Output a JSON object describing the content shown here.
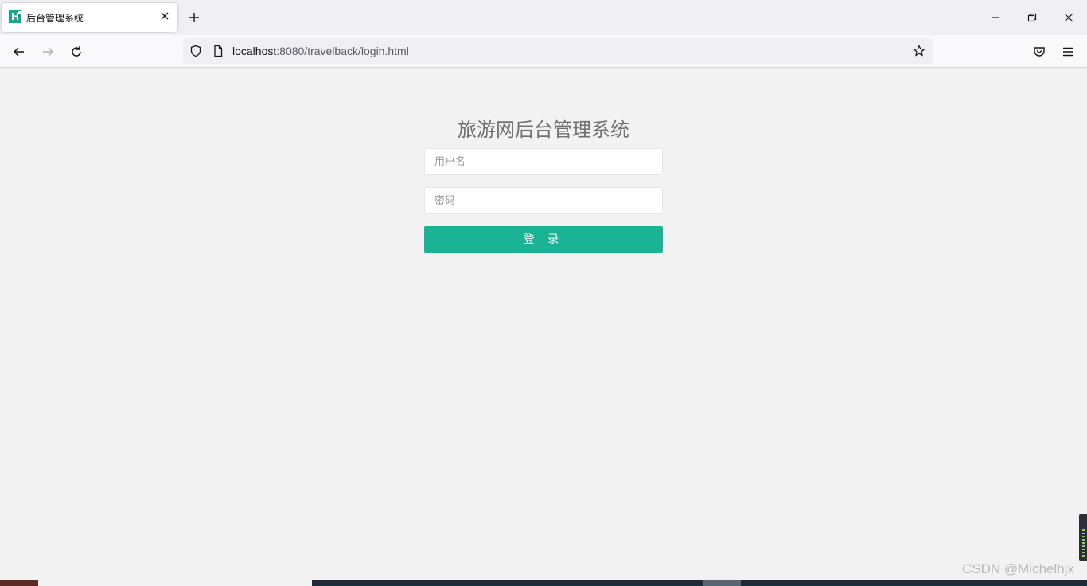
{
  "browser": {
    "tab": {
      "title": "后台管理系统",
      "favicon_letter": "H"
    },
    "url": {
      "host": "localhost",
      "rest": ":8080/travelback/login.html"
    }
  },
  "icons": {
    "close": "close-icon",
    "newtab": "plus-icon",
    "back": "arrow-left-icon",
    "forward": "arrow-right-icon",
    "reload": "reload-icon",
    "shield": "shield-icon",
    "page": "page-icon",
    "bookmark": "star-icon",
    "pocket": "pocket-icon",
    "menu": "hamburger-icon"
  },
  "login": {
    "title": "旅游网后台管理系统",
    "username_placeholder": "用户名",
    "password_placeholder": "密码",
    "submit_label": "登 录"
  },
  "watermark": "CSDN @Michelhjx",
  "colors": {
    "accent": "#1ab394",
    "page_bg": "#f2f2f2"
  }
}
